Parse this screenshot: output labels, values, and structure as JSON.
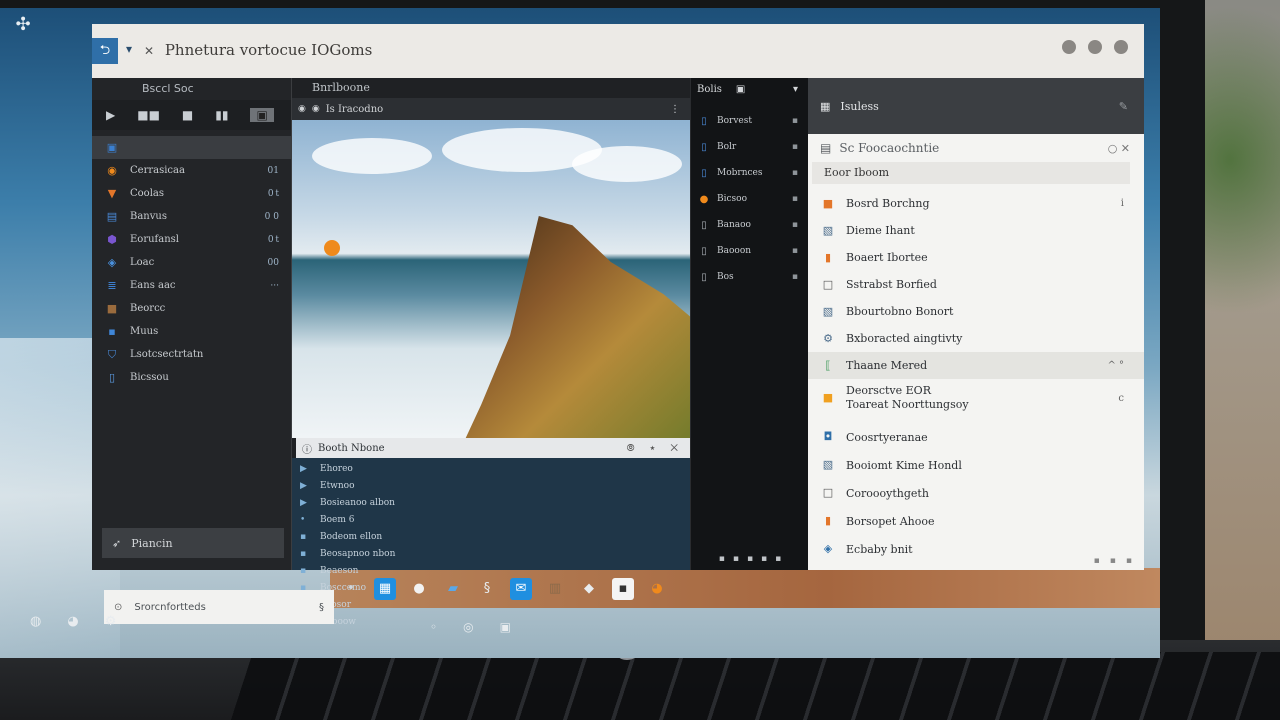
{
  "titlebar": {
    "path": "Phnetura vortocue IOGoms",
    "back_icon": "folder-back-icon",
    "window_controls": [
      "minimize",
      "maximize",
      "close"
    ]
  },
  "sidebar": {
    "header": "Bsccl Soc",
    "toolbar": [
      "▶",
      "■■",
      "■",
      "▮▮",
      "▣"
    ],
    "items": [
      {
        "label": "",
        "count": "",
        "icon": "blue-square-icon",
        "color": "#3a7fd0"
      },
      {
        "label": "Cerrasicaa",
        "count": "01",
        "icon": "orange-circle-icon",
        "color": "#f08a1c"
      },
      {
        "label": "Coolas",
        "count": "0 t",
        "icon": "orange-bin-icon",
        "color": "#e3762a"
      },
      {
        "label": "Banvus",
        "count": "0 0",
        "icon": "blue-folder-icon",
        "color": "#4a8ad8"
      },
      {
        "label": "Eorufansl",
        "count": "0 t",
        "icon": "purple-badge-icon",
        "color": "#7a56d0"
      },
      {
        "label": "Loac",
        "count": "00",
        "icon": "blue-tag-icon",
        "color": "#4a92e0"
      },
      {
        "label": "Eans aac",
        "count": "···",
        "icon": "blue-lines-icon",
        "color": "#3d7fcd"
      },
      {
        "label": "Beorcc",
        "count": "",
        "icon": "brown-box-icon",
        "color": "#9a6b3d"
      },
      {
        "label": "Muus",
        "count": "",
        "icon": "blue-box-icon",
        "color": "#3f86d8"
      },
      {
        "label": "Lsotcsectrtatn",
        "count": "",
        "icon": "blue-shield-icon",
        "color": "#4a8ad8"
      },
      {
        "label": "Bicssou",
        "count": "",
        "icon": "blue-doc-icon",
        "color": "#5b9ae0"
      }
    ],
    "bottom_item": {
      "label": "Piancin",
      "icon": "rocket-icon"
    }
  },
  "center": {
    "header": "Bnrlboone",
    "image_tab": "Is Iracodno",
    "preview_caption": "Booth Nbone",
    "preview_tools": "⦾ ⭑ ✕",
    "meta": [
      {
        "label": "Ehoreo",
        "icon": "play-icon"
      },
      {
        "label": "Etwnoo",
        "icon": "play-icon"
      },
      {
        "label": "Bosieanoo albon",
        "icon": "play-icon"
      },
      {
        "label": "Boem 6",
        "icon": "dot-icon"
      },
      {
        "label": "Bodeom ellon",
        "icon": "square-icon"
      },
      {
        "label": "Beosapnoo nbon",
        "icon": "square-icon"
      },
      {
        "label": "Beaeson",
        "icon": "square-icon"
      },
      {
        "label": "Bosccemo",
        "icon": "square-icon"
      },
      {
        "label": "Bsosor",
        "icon": "square-icon"
      },
      {
        "label": "Boooow",
        "icon": "square-icon"
      }
    ]
  },
  "narrow": {
    "header": "Bolis",
    "items": [
      {
        "label": "Borvest",
        "icon": "blue-doc-icon",
        "color": "#4a8ad8"
      },
      {
        "label": "Bolr",
        "icon": "blue-doc-icon",
        "color": "#4a8ad8"
      },
      {
        "label": "Mobrnces",
        "icon": "blue-doc-icon",
        "color": "#4a8ad8"
      },
      {
        "label": "Bicsoo",
        "icon": "orange-dot-icon",
        "color": "#f08a1c"
      },
      {
        "label": "Banaoo",
        "icon": "grey-doc-icon",
        "color": "#aab0b6"
      },
      {
        "label": "Baooon",
        "icon": "grey-doc-icon",
        "color": "#aab0b6"
      },
      {
        "label": "Bos",
        "icon": "grey-doc-icon",
        "color": "#aab0b6"
      }
    ]
  },
  "details": {
    "panel_header": "Isuless",
    "title": "Sc Foocaochntie",
    "filter": "Eoor Iboom",
    "items": [
      {
        "label": "Bosrd Borchng",
        "icon": "orange-square-icon",
        "color": "#e3762a",
        "extra": "i"
      },
      {
        "label": "Dieme Ihant",
        "icon": "image-icon",
        "color": "#4a6b8a",
        "extra": ""
      },
      {
        "label": "Boaert Ibortee",
        "icon": "orange-doc-icon",
        "color": "#e3762a",
        "extra": ""
      },
      {
        "label": "Sstrabst Borfied",
        "icon": "outline-square-icon",
        "color": "#555555",
        "extra": ""
      },
      {
        "label": "Bbourtobno Bonort",
        "icon": "image-icon",
        "color": "#4a6b8a",
        "extra": ""
      },
      {
        "label": "Bxboracted aingtivty",
        "icon": "gear-icon",
        "color": "#4a6b8a",
        "extra": ""
      },
      {
        "label": "Thaane Mered",
        "icon": "green-bracket-icon",
        "color": "#3f9a5a",
        "extra": "^ °"
      },
      {
        "label": "Deorsctve EOR",
        "label2": "Toareat Noorttungsoy",
        "icon": "orange-square-icon",
        "color": "#f0a020",
        "extra": "c"
      }
    ],
    "lower_items": [
      {
        "label": "Coosrtyeranae",
        "icon": "blue-badge-icon",
        "color": "#2f6fa8"
      },
      {
        "label": "Booiomt Kime Hondl",
        "icon": "image-icon",
        "color": "#4a6b8a"
      },
      {
        "label": "Coroooythgeth",
        "icon": "outline-square-icon",
        "color": "#555555"
      },
      {
        "label": "Borsopet Ahooe",
        "icon": "orange-doc-icon",
        "color": "#e3762a"
      },
      {
        "label": "Ecbaby bnit",
        "icon": "blue-tag-icon",
        "color": "#2f6fa8"
      }
    ]
  },
  "taskbar": {
    "search_text": "Srorcnfortteds",
    "search_button": "§",
    "dock_icons": [
      "dot-icon",
      "store-icon",
      "apple-icon",
      "folder-icon",
      "link-icon",
      "mail-icon",
      "terminal-icon",
      "tag-icon",
      "square-icon",
      "firefox-icon"
    ]
  },
  "brand": {
    "logo_text": "hp"
  }
}
